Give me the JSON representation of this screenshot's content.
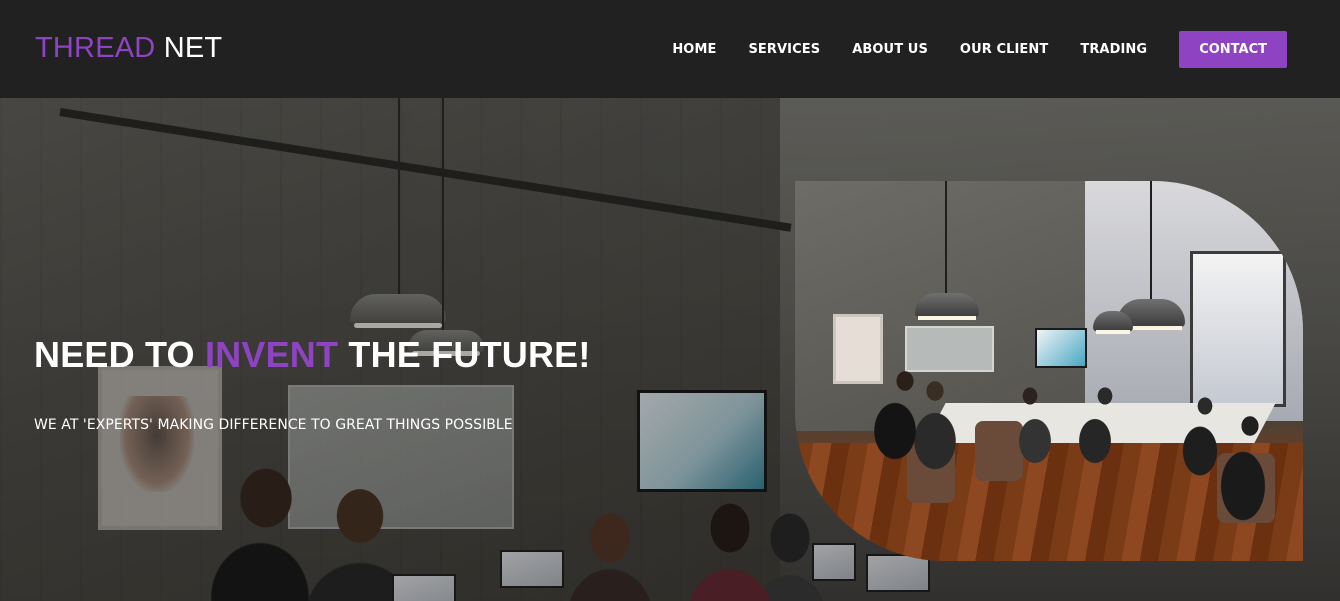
{
  "brand": {
    "part_a": "THREAD",
    "part_b": "NET"
  },
  "nav": {
    "items": [
      {
        "label": "HOME"
      },
      {
        "label": "SERVICES"
      },
      {
        "label": "ABOUT US"
      },
      {
        "label": "OUR CLIENT"
      },
      {
        "label": "TRADING"
      }
    ],
    "cta_label": "CONTACT"
  },
  "hero": {
    "title_before": "NEED TO ",
    "title_accent": "INVENT",
    "title_after": " THE FUTURE!",
    "subtitle": "WE AT 'EXPERTS' MAKING DIFFERENCE TO GREAT THINGS POSSIBLE"
  },
  "theme": {
    "accent": "#8e44c2",
    "navbar_bg": "#212121",
    "text": "#ffffff"
  }
}
